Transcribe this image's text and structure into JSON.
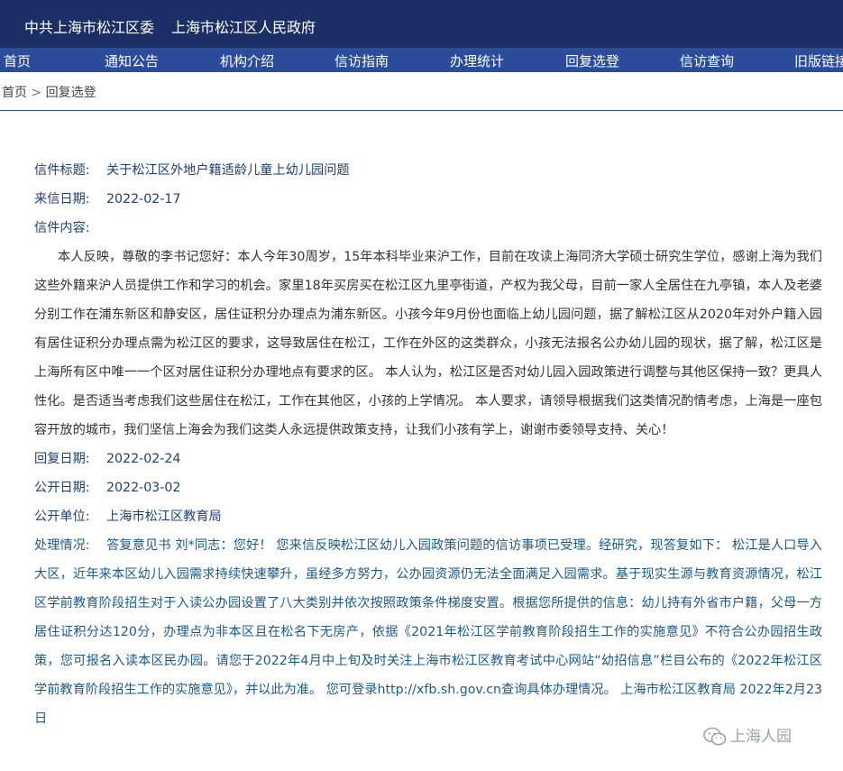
{
  "header": {
    "left_title": "中共上海市松江区委",
    "right_title": "上海市松江区人民政府"
  },
  "nav": {
    "items": [
      "首页",
      "通知公告",
      "机构介绍",
      "信访指南",
      "办理统计",
      "回复选登",
      "信访查询",
      "旧版链接"
    ]
  },
  "breadcrumb": {
    "home": "首页",
    "separator": ">",
    "current": "回复选登"
  },
  "letter": {
    "title_label": "信件标题:",
    "title": "关于松江区外地户籍适龄儿童上幼儿园问题",
    "date_label": "来信日期:",
    "date": "2022-02-17",
    "content_label": "信件内容:",
    "content": "本人反映，尊敬的李书记您好：本人今年30周岁，15年本科毕业来沪工作，目前在攻读上海同济大学硕士研究生学位，感谢上海为我们这些外籍来沪人员提供工作和学习的机会。家里18年买房买在松江区九里亭街道，产权为我父母，目前一家人全居住在九亭镇，本人及老婆分别工作在浦东新区和静安区，居住证积分办理点为浦东新区。小孩今年9月份也面临上幼儿园问题，据了解松江区从2020年对外户籍入园有居住证积分办理点需为松江区的要求，这导致居住在松江，工作在外区的这类群众，小孩无法报名公办幼儿园的现状，据了解，松江区是上海所有区中唯一一个区对居住证积分办理地点有要求的区。 本人认为，松江区是否对幼儿园入园政策进行调整与其他区保持一致？更具人性化。是否适当考虑我们这些居住在松江，工作在其他区，小孩的上学情况。 本人要求，请领导根据我们这类情况酌情考虑，上海是一座包容开放的城市，我们坚信上海会为我们这类人永远提供政策支持，让我们小孩有学上，谢谢市委领导支持、关心！"
  },
  "reply": {
    "reply_date_label": "回复日期:",
    "reply_date": "2022-02-24",
    "public_date_label": "公开日期:",
    "public_date": "2022-03-02",
    "unit_label": "公开单位:",
    "unit": "上海市松江区教育局",
    "handling_label": "处理情况:",
    "handling": "答复意见书 刘*同志：您好！ 您来信反映松江区幼儿入园政策问题的信访事项已受理。经研究，现答复如下： 松江是人口导入大区，近年来本区幼儿入园需求持续快速攀升，虽经多方努力，公办园资源仍无法全面满足入园需求。基于现实生源与教育资源情况，松江区学前教育阶段招生对于入读公办园设置了八大类别并依次按照政策条件梯度安置。根据您所提供的信息：幼儿持有外省市户籍，父母一方居住证积分达120分，办理点为非本区且在松名下无房产，依据《2021年松江区学前教育阶段招生工作的实施意见》不符合公办园招生政策，您可报名入读本区民办园。请您于2022年4月中上旬及时关注上海市松江区教育考试中心网站“幼招信息”栏目公布的《2022年松江区学前教育阶段招生工作的实施意见》，并以此为准。 您可登录http://xfb.sh.gov.cn查询具体办理情况。 上海市松江区教育局 2022年2月23日"
  },
  "watermark": {
    "text": "上海人园",
    "icon": "wechat-icon"
  }
}
